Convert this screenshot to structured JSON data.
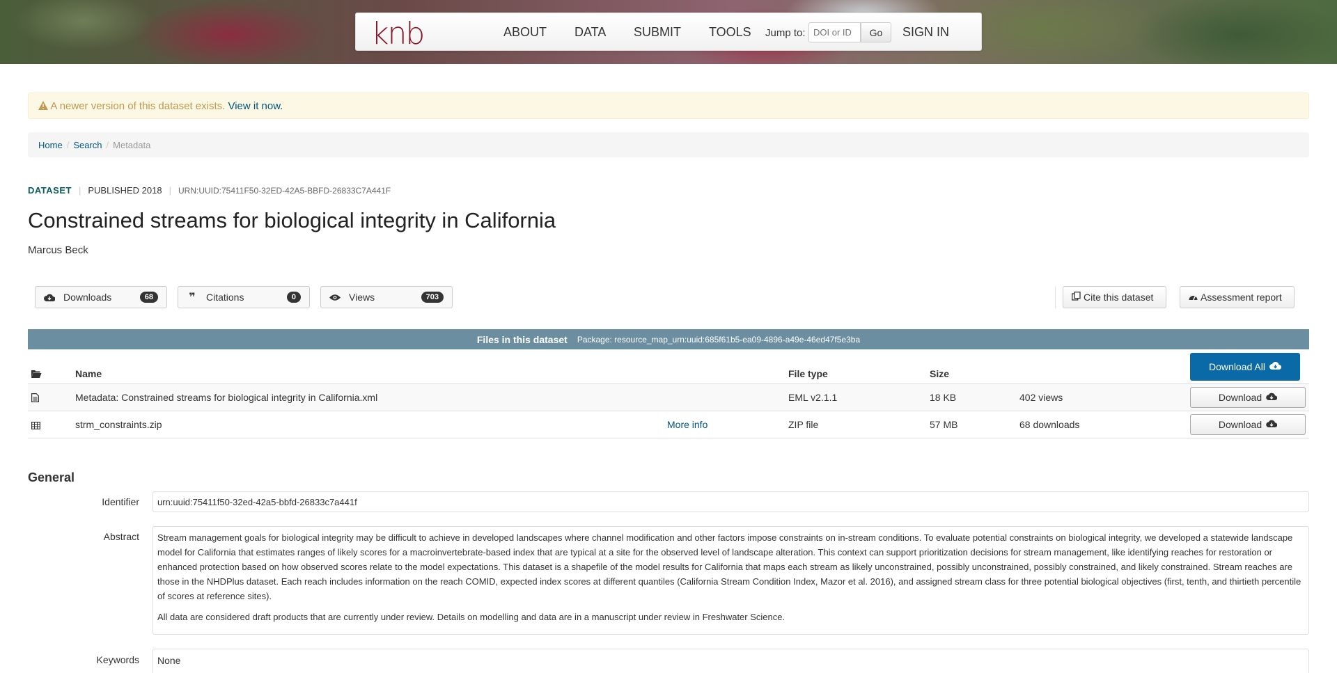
{
  "header": {
    "logo": "knb",
    "nav": [
      "ABOUT",
      "DATA",
      "SUBMIT",
      "TOOLS"
    ],
    "jump_label": "Jump to:",
    "jump_placeholder": "DOI or ID",
    "go_label": "Go",
    "sign_in": "SIGN IN"
  },
  "alert": {
    "text": "A newer version of this dataset exists.",
    "link": "View it now."
  },
  "breadcrumb": {
    "home": "Home",
    "search": "Search",
    "current": "Metadata"
  },
  "dataset": {
    "type": "DATASET",
    "published": "PUBLISHED 2018",
    "id": "URN:UUID:75411F50-32ED-42A5-BBFD-26833C7A441F",
    "title": "Constrained streams for biological integrity in California",
    "author": "Marcus Beck"
  },
  "metrics": {
    "downloads": {
      "label": "Downloads",
      "count": "68"
    },
    "citations": {
      "label": "Citations",
      "count": "0"
    },
    "views": {
      "label": "Views",
      "count": "703"
    }
  },
  "actions": {
    "cite": "Cite this dataset",
    "assessment": "Assessment report"
  },
  "files": {
    "header_title": "Files in this dataset",
    "package": "Package: resource_map_urn:uuid:685f61b5-ea09-4896-a49e-46ed47f5e3ba",
    "columns": {
      "name": "Name",
      "type": "File type",
      "size": "Size"
    },
    "download_all": "Download All",
    "rows": [
      {
        "name": "Metadata: Constrained streams for biological integrity in California.xml",
        "more": "",
        "type": "EML v2.1.1",
        "size": "18 KB",
        "stat": "402 views",
        "button": "Download"
      },
      {
        "name": "strm_constraints.zip",
        "more": "More info",
        "type": "ZIP file",
        "size": "57 MB",
        "stat": "68 downloads",
        "button": "Download"
      }
    ]
  },
  "general": {
    "title": "General",
    "identifier_label": "Identifier",
    "identifier": "urn:uuid:75411f50-32ed-42a5-bbfd-26833c7a441f",
    "abstract_label": "Abstract",
    "abstract_p1": "Stream management goals for biological integrity may be difficult to achieve in developed landscapes where channel modification and other factors impose constraints on in-stream conditions. To evaluate potential constraints on biological integrity, we developed a statewide landscape model for California that estimates ranges of likely scores for a macroinvertebrate-based index that are typical at a site for the observed level of landscape alteration. This context can support prioritization decisions for stream management, like identifying reaches for restoration or enhanced protection based on how observed scores relate to the model expectations. This dataset is a shapefile of the model results for California that maps each stream as likely unconstrained, possibly unconstrained, possibly constrained, and likely constrained. Stream reaches are those in the NHDPlus dataset. Each reach includes information on the reach COMID, expected index scores at different quantiles (California Stream Condition Index, Mazor et al. 2016), and assigned stream class for three potential biological objectives (first, tenth, and thirtieth percentile of scores at reference sites).",
    "abstract_p2": "All data are considered draft products that are currently under review. Details on modelling and data are in a manuscript under review in Freshwater Science.",
    "keywords_label": "Keywords",
    "keywords": "None"
  }
}
